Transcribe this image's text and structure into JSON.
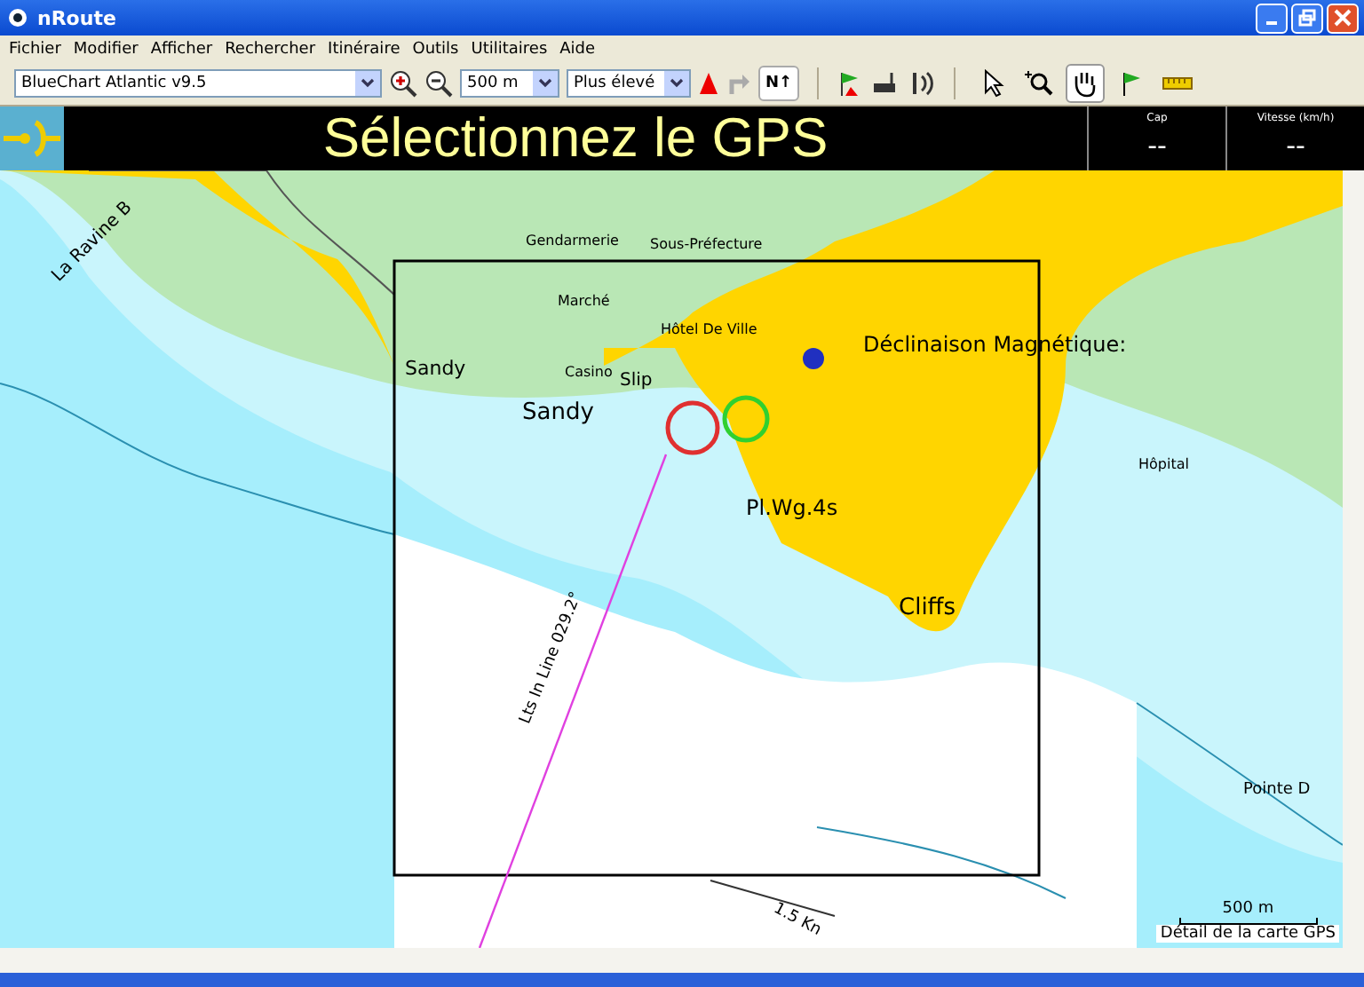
{
  "window": {
    "title": "nRoute"
  },
  "menu": [
    "Fichier",
    "Modifier",
    "Afficher",
    "Rechercher",
    "Itinéraire",
    "Outils",
    "Utilitaires",
    "Aide"
  ],
  "toolbar": {
    "chart_select": "BlueChart Atlantic v9.5",
    "scale_select": "500 m",
    "detail_select": "Plus élevé",
    "north_button": "N↑",
    "tools": [
      {
        "kind": "pointer",
        "selected": false
      },
      {
        "kind": "zoom",
        "selected": false
      },
      {
        "kind": "pan",
        "selected": true
      },
      {
        "kind": "flag",
        "selected": false
      },
      {
        "kind": "ruler",
        "selected": false
      }
    ]
  },
  "header": {
    "title": "Sélectionnez le GPS",
    "instruments": [
      {
        "label": "Cap",
        "value": "--"
      },
      {
        "label": "Vitesse (km/h)",
        "value": "--"
      }
    ]
  },
  "map": {
    "labels": [
      "La Ravine B",
      "Gendarmerie",
      "Sous-Préfecture",
      "Marché",
      "Hôtel De Ville",
      "Sandy",
      "Casino",
      "Slip",
      "Sandy",
      "Déclinaison Magnétique:",
      "Hôpital",
      "Pl.Wg.4s",
      "Cliffs",
      "Lts In Line 029.2°",
      "1.5 Kn",
      "Pointe D"
    ],
    "scale": "500 m",
    "caption": "Détail de la carte GPS"
  }
}
